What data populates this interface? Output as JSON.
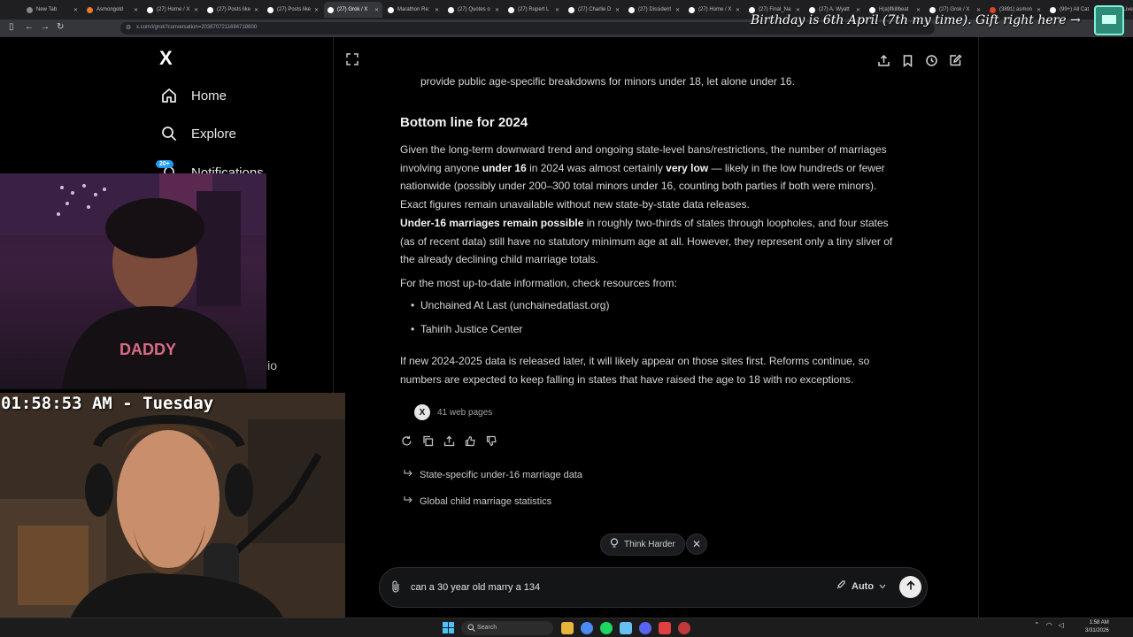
{
  "browser": {
    "tabs": [
      {
        "label": "New Tab",
        "icon": "chrome-icon",
        "active": false
      },
      {
        "label": "Asmongold",
        "icon": "orange-icon",
        "active": false
      },
      {
        "label": "(27) Home / X",
        "icon": "x-icon",
        "active": false
      },
      {
        "label": "(27) Posts like",
        "icon": "x-icon",
        "active": false
      },
      {
        "label": "(27) Posts like",
        "icon": "x-icon",
        "active": false
      },
      {
        "label": "(27) Grok / X",
        "icon": "x-icon",
        "active": true
      },
      {
        "label": "Marathon Re:",
        "icon": "x-icon",
        "active": false
      },
      {
        "label": "(27) Quotes o",
        "icon": "x-icon",
        "active": false
      },
      {
        "label": "(27) Rupert L",
        "icon": "x-icon",
        "active": false
      },
      {
        "label": "(27) Charlie D",
        "icon": "x-icon",
        "active": false
      },
      {
        "label": "(27) Dissident",
        "icon": "x-icon",
        "active": false
      },
      {
        "label": "(27) Home / X",
        "icon": "x-icon",
        "active": false
      },
      {
        "label": "(27) Final_Na",
        "icon": "x-icon",
        "active": false
      },
      {
        "label": "(27) A. Wyatt",
        "icon": "x-icon",
        "active": false
      },
      {
        "label": "H(a)lfkillbeat",
        "icon": "x-icon",
        "active": false
      },
      {
        "label": "(27) Grok / X",
        "icon": "x-icon",
        "active": false
      },
      {
        "label": "(3891) asmon",
        "icon": "red-icon",
        "active": false
      },
      {
        "label": "(99+) All Cat",
        "icon": "x-icon",
        "active": false
      },
      {
        "label": "r/Livestreamf",
        "icon": "orange-icon",
        "active": false
      }
    ],
    "url": "x.com/i/grok?conversation=2038707211694718800"
  },
  "overlay": {
    "birthday_text": "Birthday is 6th April (7th my time). Gift right here →",
    "clock_text": "01:58:53 AM - Tuesday"
  },
  "sidebar": {
    "logo": "X",
    "items": [
      {
        "label": "Home",
        "icon": "home-icon"
      },
      {
        "label": "Explore",
        "icon": "search-icon"
      },
      {
        "label": "Notifications",
        "icon": "bell-icon",
        "badge": "20+"
      }
    ],
    "partial_label": "lio"
  },
  "response": {
    "intro_tail": "provide public age-specific breakdowns for minors under 18, let alone under 16.",
    "heading": "Bottom line for 2024",
    "p1": {
      "pre": "Given the long-term downward trend and ongoing state-level bans/restrictions, the number of marriages involving anyone ",
      "b1": "under 16",
      "mid": " in 2024 was almost certainly ",
      "b2": "very low",
      "post": " — likely in the low hundreds or fewer nationwide (possibly under 200–300 total minors under 16, counting both parties if both were minors). Exact figures remain unavailable without new state-by-state data releases."
    },
    "p2": {
      "b": "Under-16 marriages remain possible",
      "post": " in roughly two-thirds of states through loopholes, and four states (as of recent data) still have no statutory minimum age at all. However, they represent only a tiny sliver of the already declining child marriage totals."
    },
    "resources_intro": "For the most up-to-date information, check resources from:",
    "resources": [
      "Unchained At Last (unchainedatlast.org)",
      "Tahirih Justice Center"
    ],
    "closing": "If new 2024-2025 data is released later, it will likely appear on those sites first. Reforms continue, so numbers are expected to keep falling in states that have raised the age to 18 with no exceptions.",
    "sources_label": "41 web pages",
    "followups": [
      "State-specific under-16 marriage data",
      "Global child marriage statistics"
    ]
  },
  "composer": {
    "think_harder": "Think Harder",
    "input_value": "can a 30 year old marry a 134",
    "mode": "Auto"
  },
  "taskbar": {
    "search_label": "Search",
    "time": "1:58 AM",
    "date": "3/31/2026"
  },
  "colors": {
    "accent": "#1d9bf0",
    "background": "#000000",
    "text": "#e7e9ea"
  }
}
